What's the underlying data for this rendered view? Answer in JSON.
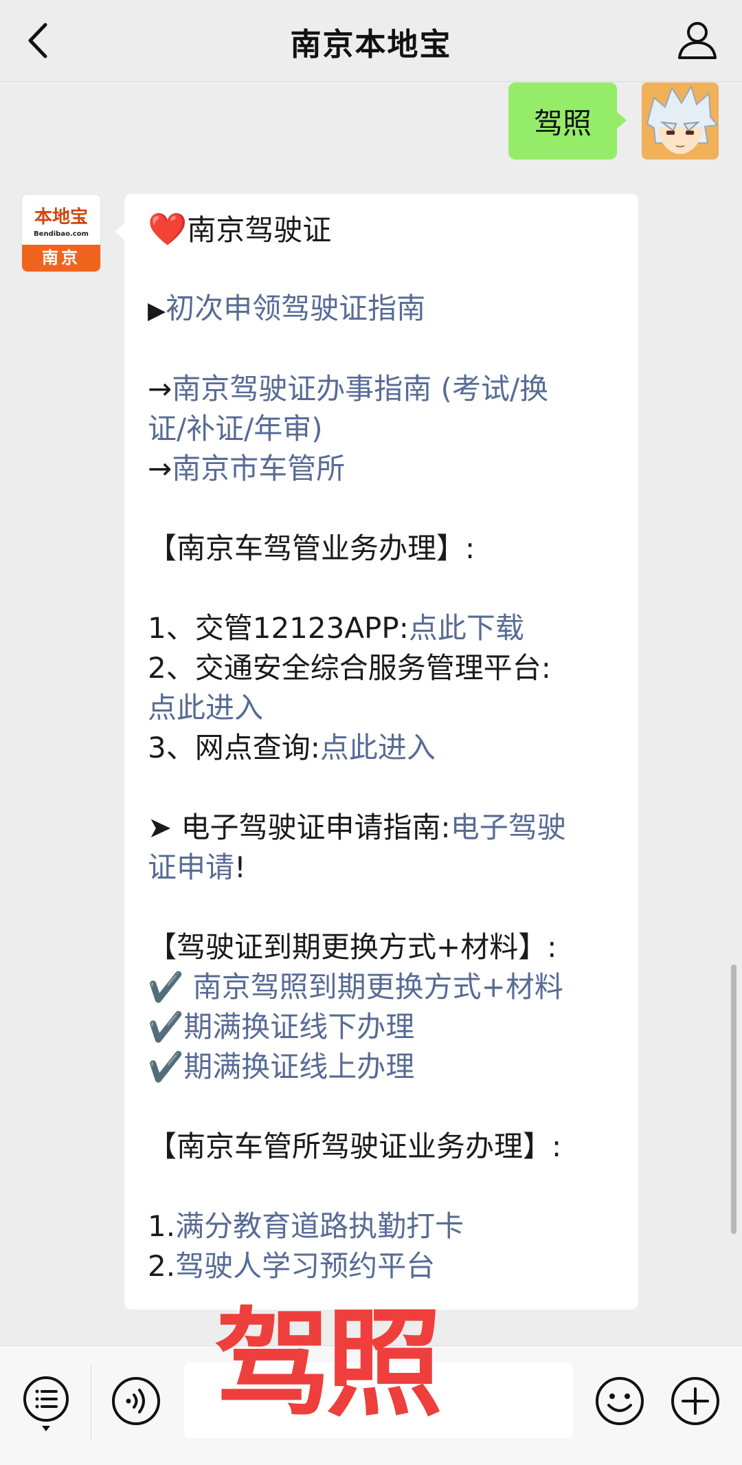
{
  "header": {
    "title": "南京本地宝"
  },
  "outgoing": {
    "text": "驾照"
  },
  "bot_avatar": {
    "logo_text": "本地宝",
    "logo_sub": "Bendibao.com",
    "city": "南京"
  },
  "message": {
    "title_emoji": "❤️",
    "title": "南京驾驶证",
    "first_prefix": "▶",
    "first_link": "初次申领驾驶证指南",
    "arrow": "→",
    "guide_link_1": "南京驾驶证办事指南 (考试/换",
    "guide_link_2": "证/补证/年审)",
    "office_link": "南京市车管所",
    "section1_title": "【南京车驾管业务办理】:",
    "item1_text": "1、交管12123APP:",
    "item1_link": "点此下载",
    "item2_text": "2、交通安全综合服务管理平台:",
    "item2_link": "点此进入",
    "item3_text": "3、网点查询:",
    "item3_link": "点此进入",
    "edl_prefix": "➤ 电子驾驶证申请指南:",
    "edl_link_1": "电子驾驶",
    "edl_link_2": "证申请",
    "edl_suffix": "!",
    "section2_title": "【驾驶证到期更换方式+材料】:",
    "check": "✔️",
    "check1_link": " 南京驾照到期更换方式+材料",
    "check2_link": "期满换证线下办理",
    "check3_link": "期满换证线上办理",
    "section3_title": "【南京车管所驾驶证业务办理】:",
    "num1": "1.",
    "num1_link": "满分教育道路执勤打卡",
    "num2": "2.",
    "num2_link": "驾驶人学习预约平台"
  },
  "overlay_text": "驾照",
  "icons": {
    "back": "back-chevron-icon",
    "user": "user-profile-icon",
    "menu": "menu-list-icon",
    "voice": "voice-icon",
    "emoji": "emoji-icon",
    "plus": "plus-icon"
  },
  "colors": {
    "background": "#ededed",
    "outgoing_bubble": "#95ec69",
    "link": "#576b95",
    "overlay": "#ee3f3c",
    "brand_orange": "#f0641e"
  }
}
